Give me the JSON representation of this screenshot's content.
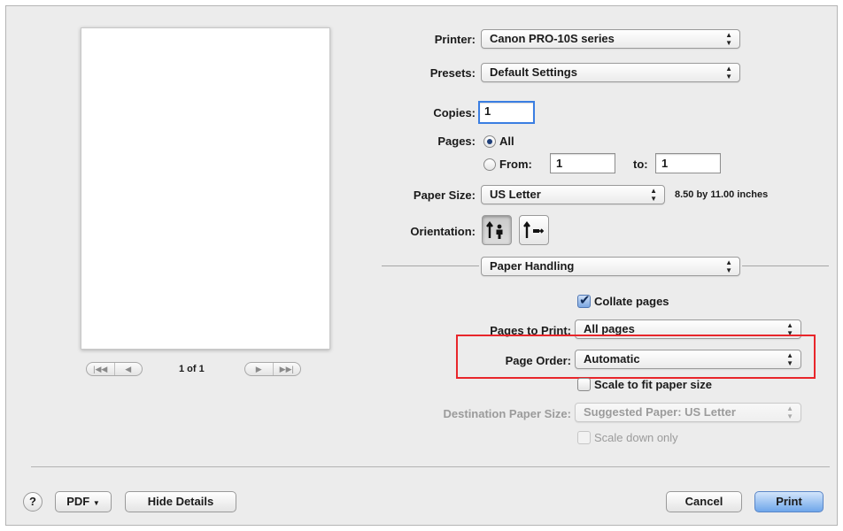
{
  "printer": {
    "label": "Printer:",
    "value": "Canon PRO-10S series"
  },
  "presets": {
    "label": "Presets:",
    "value": "Default Settings"
  },
  "copies": {
    "label": "Copies:",
    "value": "1"
  },
  "pages": {
    "label": "Pages:",
    "all_label": "All",
    "from_label": "From:",
    "from_value": "1",
    "to_label": "to:",
    "to_value": "1"
  },
  "paper_size": {
    "label": "Paper Size:",
    "value": "US Letter",
    "dimensions": "8.50 by 11.00 inches"
  },
  "orientation": {
    "label": "Orientation:",
    "selected": "portrait"
  },
  "section": {
    "value": "Paper Handling"
  },
  "collate": {
    "label": "Collate pages",
    "checked": true
  },
  "pages_to_print": {
    "label": "Pages to Print:",
    "value": "All pages"
  },
  "page_order": {
    "label": "Page Order:",
    "value": "Automatic",
    "highlight_color": "#e8262b"
  },
  "scale_fit": {
    "label": "Scale to fit paper size",
    "checked": false
  },
  "dest_paper": {
    "label": "Destination Paper Size:",
    "value": "Suggested Paper: US Letter"
  },
  "scale_down": {
    "label": "Scale down only"
  },
  "preview": {
    "page_indicator": "1 of 1"
  },
  "footer": {
    "help": "?",
    "pdf_label": "PDF",
    "hide_details": "Hide Details",
    "cancel": "Cancel",
    "print": "Print"
  },
  "colors": {
    "accent": "#3a7ee2",
    "highlight": "#e8262b"
  }
}
